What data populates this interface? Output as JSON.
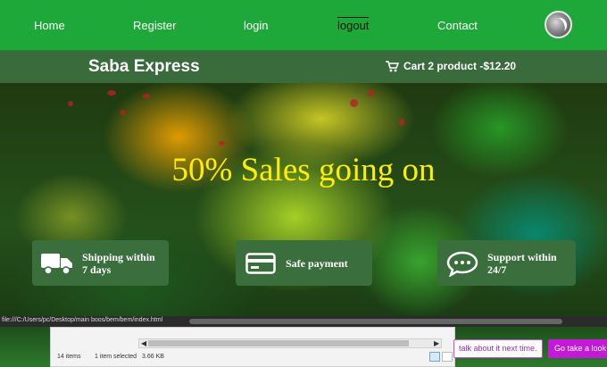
{
  "nav": {
    "items": [
      {
        "label": "Home"
      },
      {
        "label": "Register"
      },
      {
        "label": "login"
      },
      {
        "label": "logout"
      },
      {
        "label": "Contact"
      }
    ],
    "active": "logout",
    "avatar_icon": "user-avatar"
  },
  "brand": {
    "name": "Saba Express"
  },
  "cart": {
    "icon": "cart-icon",
    "label": "Cart 2 product -$12.20"
  },
  "hero": {
    "headline": "50% Sales going on"
  },
  "features": [
    {
      "icon": "truck-icon",
      "label_line1": "Shipping within",
      "label_line2": "7 days"
    },
    {
      "icon": "credit-card-icon",
      "label_line1": "Safe payment",
      "label_line2": ""
    },
    {
      "icon": "chat-bubble-icon",
      "label_line1": "Support within",
      "label_line2": "24/7"
    }
  ],
  "status_bar": {
    "url": "file:///C:/Users/pc/Desktop/main boos/bem/bem/index.html"
  },
  "file_explorer": {
    "items_count": "14 items",
    "selection": "1 item selected",
    "size": "3.66 KB"
  },
  "promo": {
    "secondary": "talk about it next time.",
    "primary": "Go take a look"
  },
  "colors": {
    "nav_bg": "#1fa83a",
    "brandbar_bg": "#3a6b3c",
    "headline": "#ffee00",
    "feature_bg": "#3a6e3c",
    "promo_primary": "#c21ad6"
  }
}
